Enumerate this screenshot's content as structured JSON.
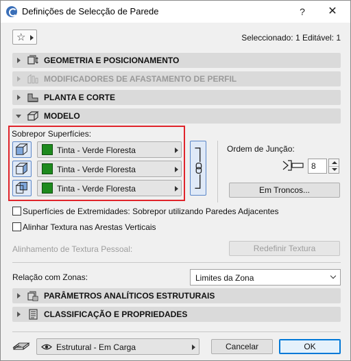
{
  "window": {
    "title": "Definições de Selecção de Parede",
    "help_label": "?",
    "close_label": "✕"
  },
  "toolbar": {
    "favorites_icon": "star-icon",
    "selection_info": "Seleccionado: 1 Editável: 1"
  },
  "panels": {
    "geometry": {
      "label": "GEOMETRIA E POSICIONAMENTO",
      "icon": "geometry-icon",
      "expanded": false
    },
    "profile_modifiers": {
      "label": "MODIFICADORES DE AFASTAMENTO DE PERFIL",
      "icon": "profile-modifier-icon",
      "expanded": false,
      "disabled": true
    },
    "plan_section": {
      "label": "PLANTA E CORTE",
      "icon": "plan-section-icon",
      "expanded": false
    },
    "model": {
      "label": "MODELO",
      "icon": "model-icon",
      "expanded": true
    },
    "structural": {
      "label": "PARÂMETROS ANALÍTICOS ESTRUTURAIS",
      "icon": "structural-analytic-icon",
      "expanded": false
    },
    "classification": {
      "label": "CLASSIFICAÇÃO E PROPRIEDADES",
      "icon": "classification-icon",
      "expanded": false
    }
  },
  "model": {
    "override_label": "Sobrepor Superfícies:",
    "surfaces": [
      {
        "side": "outside",
        "material": "Tinta - Verde Floresta",
        "swatch_color": "#1e8a1e"
      },
      {
        "side": "edge",
        "material": "Tinta - Verde Floresta",
        "swatch_color": "#1e8a1e"
      },
      {
        "side": "inside",
        "material": "Tinta - Verde Floresta",
        "swatch_color": "#1e8a1e"
      }
    ],
    "chain_icon": "chain-link-icon",
    "join_order_label": "Ordem de Junção:",
    "join_order_value": "8",
    "in_trunks_button": "Em Troncos...",
    "end_surfaces_label": "Superfícies de Extremidades: Sobrepor utilizando Paredes Adjacentes",
    "end_surfaces_checked": false,
    "align_texture_label": "Alinhar Textura nas Arestas Verticais",
    "align_texture_checked": false,
    "custom_texture_label": "Alinhamento de Textura Pessoal:",
    "reset_texture_button": "Redefinir Textura",
    "zone_relation_label": "Relação com Zonas:",
    "zone_relation_value": "Limites da Zona"
  },
  "footer": {
    "layer_icon": "layer-icon",
    "eye_icon": "eye-icon",
    "layer_name": "Estrutural - Em Carga",
    "cancel_label": "Cancelar",
    "ok_label": "OK"
  },
  "colors": {
    "highlight_box": "#e0232a",
    "material_swatch": "#1e8a1e",
    "accent_blue": "#0078d7"
  }
}
